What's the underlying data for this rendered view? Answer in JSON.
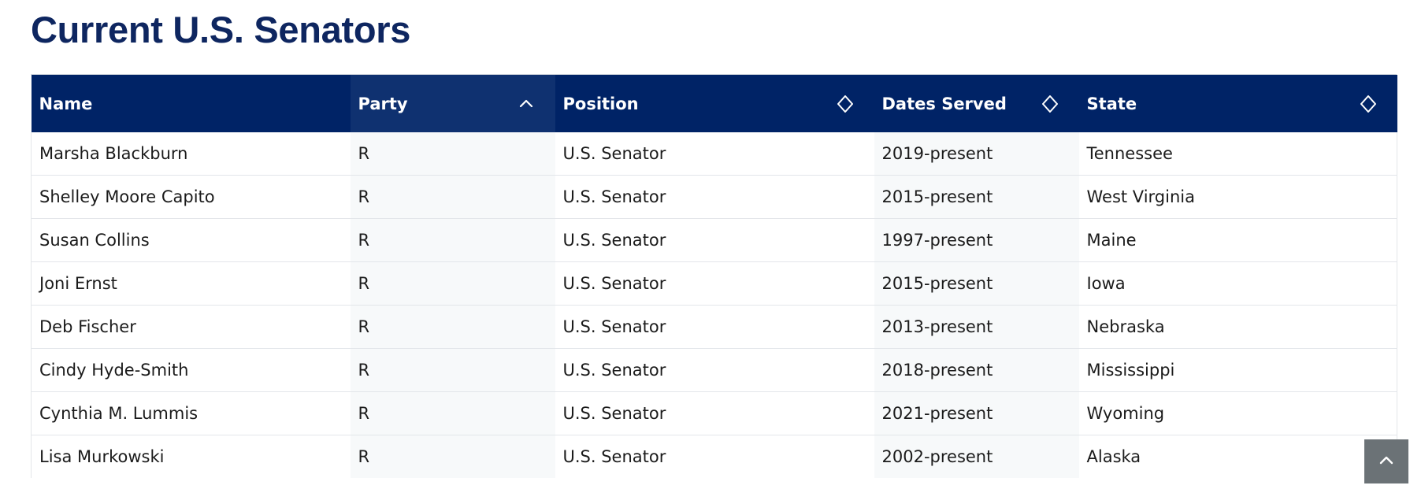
{
  "page": {
    "title": "Current U.S. Senators"
  },
  "table": {
    "headers": {
      "name": "Name",
      "party": "Party",
      "position": "Position",
      "dates": "Dates Served",
      "state": "State"
    },
    "sort": {
      "column": "party",
      "direction": "ascending"
    },
    "rows": [
      {
        "name": "Marsha Blackburn",
        "party": "R",
        "position": "U.S. Senator",
        "dates": "2019-present",
        "state": "Tennessee"
      },
      {
        "name": "Shelley Moore Capito",
        "party": "R",
        "position": "U.S. Senator",
        "dates": "2015-present",
        "state": "West Virginia"
      },
      {
        "name": "Susan Collins",
        "party": "R",
        "position": "U.S. Senator",
        "dates": "1997-present",
        "state": "Maine"
      },
      {
        "name": "Joni Ernst",
        "party": "R",
        "position": "U.S. Senator",
        "dates": "2015-present",
        "state": "Iowa"
      },
      {
        "name": "Deb Fischer",
        "party": "R",
        "position": "U.S. Senator",
        "dates": "2013-present",
        "state": "Nebraska"
      },
      {
        "name": "Cindy Hyde-Smith",
        "party": "R",
        "position": "U.S. Senator",
        "dates": "2018-present",
        "state": "Mississippi"
      },
      {
        "name": "Cynthia M. Lummis",
        "party": "R",
        "position": "U.S. Senator",
        "dates": "2021-present",
        "state": "Wyoming"
      },
      {
        "name": "Lisa Murkowski",
        "party": "R",
        "position": "U.S. Senator",
        "dates": "2002-present",
        "state": "Alaska"
      }
    ]
  },
  "icons": {
    "sort_ascending": "chevron-up-icon",
    "sort_unsorted": "sort-icon",
    "back_to_top": "chevron-up-icon"
  },
  "colors": {
    "title": "#0e2660",
    "header_bg": "#002366",
    "header_sorted_bg": "#0f3170",
    "shaded_column": "#f7f9fa",
    "back_to_top_bg": "#6b7276"
  }
}
